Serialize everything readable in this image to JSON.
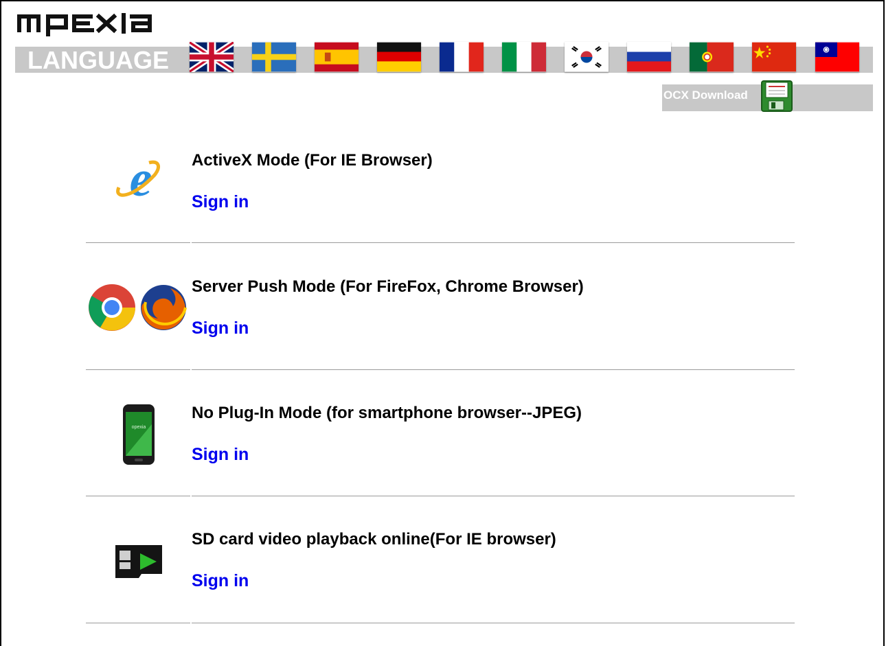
{
  "brand": {
    "logo_text": "opexia"
  },
  "language": {
    "label": "LANGUAGE",
    "flags": [
      {
        "name": "flag-uk"
      },
      {
        "name": "flag-sweden"
      },
      {
        "name": "flag-spain"
      },
      {
        "name": "flag-germany"
      },
      {
        "name": "flag-france"
      },
      {
        "name": "flag-italy"
      },
      {
        "name": "flag-korea"
      },
      {
        "name": "flag-russia"
      },
      {
        "name": "flag-portugal"
      },
      {
        "name": "flag-china"
      },
      {
        "name": "flag-taiwan"
      }
    ]
  },
  "ocx": {
    "label": "OCX Download",
    "icon": "floppy-disk-icon"
  },
  "modes": [
    {
      "title": "ActiveX Mode (For IE Browser)",
      "signin": "Sign in",
      "icon": "internet-explorer-icon"
    },
    {
      "title": "Server Push Mode (For FireFox, Chrome Browser)",
      "signin": "Sign in",
      "icon": "chrome-firefox-icons"
    },
    {
      "title": "No Plug-In Mode (for smartphone browser--JPEG)",
      "signin": "Sign in",
      "icon": "smartphone-icon"
    },
    {
      "title": "SD card video playback online(For IE browser)",
      "signin": "Sign in",
      "icon": "sd-card-icon"
    }
  ],
  "colors": {
    "bar": "#c8c8c8",
    "link": "#0000ee"
  }
}
